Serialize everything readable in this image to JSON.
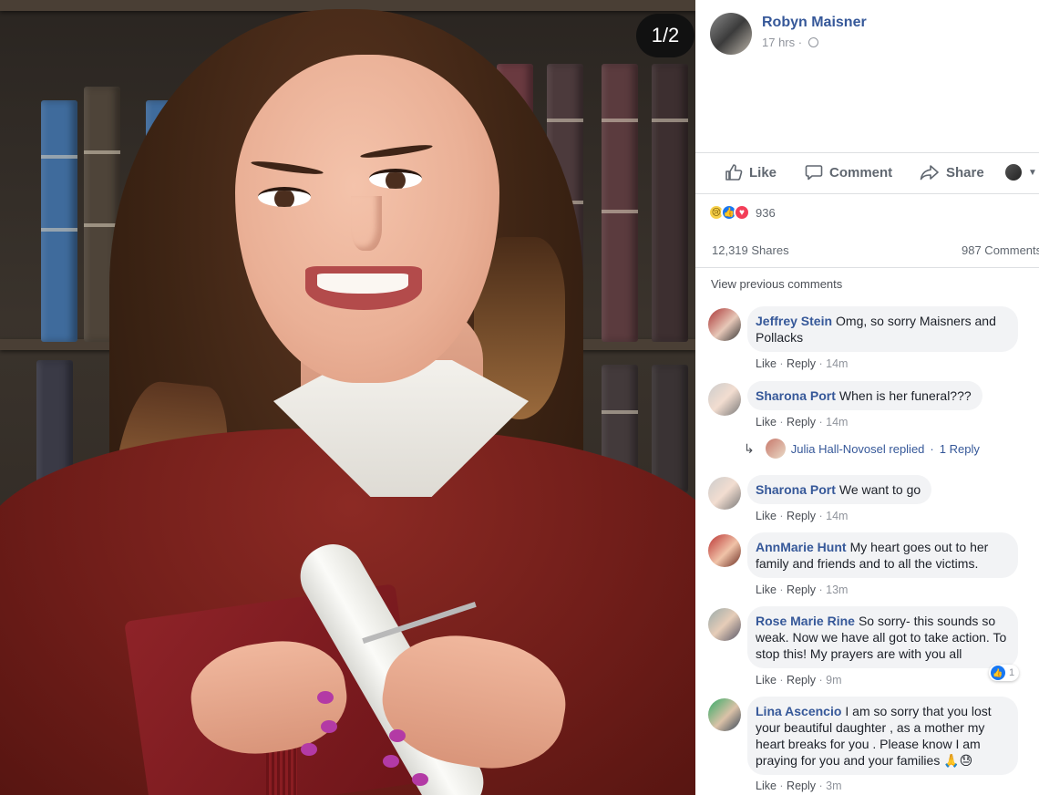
{
  "viewer": {
    "photo_counter": "1/2",
    "photo_alt": "Graduation portrait photo"
  },
  "post": {
    "author": "Robyn Maisner",
    "time": "17 hrs",
    "more_icon": "more-options-icon",
    "actions": {
      "like": "Like",
      "comment": "Comment",
      "share": "Share"
    },
    "reactions": {
      "count": "936",
      "types": [
        "sad",
        "like",
        "love"
      ]
    },
    "shares": "12,319 Shares",
    "comments_count": "987 Comments",
    "view_previous": "View previous comments"
  },
  "comment_meta": {
    "like": "Like",
    "reply": "Reply"
  },
  "comments": [
    {
      "name": "Jeffrey Stein",
      "text": "Omg, so sorry Maisners and Pollacks",
      "time": "14m"
    },
    {
      "name": "Sharona Port",
      "text": "When is her funeral???",
      "time": "14m",
      "replies": {
        "replier": "Julia Hall-Novosel replied",
        "count": "1 Reply"
      }
    },
    {
      "name": "Sharona Port",
      "text": "We want to go",
      "time": "14m"
    },
    {
      "name": "AnnMarie Hunt",
      "text": "My heart goes out to her family and friends and to all the victims.",
      "time": "13m"
    },
    {
      "name": "Rose Marie Rine",
      "text": "So sorry- this sounds so weak. Now we have all got to take action. To stop this! My prayers are with you all",
      "time": "9m",
      "likes": "1"
    },
    {
      "name": "Lina Ascencio",
      "text": "I am so sorry that you lost your beautiful daughter , as a mother my heart breaks for you . Please know I am praying for you and your families 🙏😓",
      "time": "3m"
    }
  ],
  "colors": {
    "link_blue": "#365899",
    "meta_gray": "#90949c",
    "bubble_bg": "#f2f3f5",
    "gown_red": "#6f1d19"
  }
}
